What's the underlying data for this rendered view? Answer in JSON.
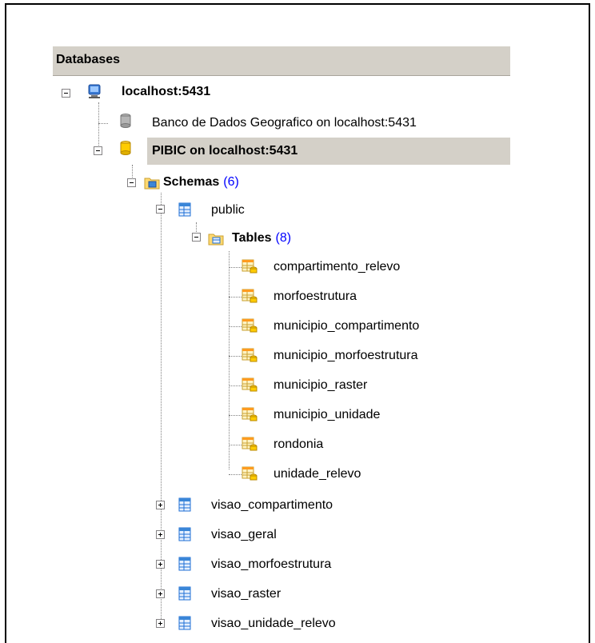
{
  "panel": {
    "header": "Databases"
  },
  "tree": {
    "server": {
      "label": "localhost:5431"
    },
    "db_geo": {
      "label": "Banco de Dados Geografico on localhost:5431"
    },
    "db_pibic": {
      "label": "PIBIC on localhost:5431"
    },
    "schemas": {
      "label": "Schemas",
      "count": "(6)"
    },
    "schema_public": {
      "label": "public"
    },
    "tables": {
      "label": "Tables",
      "count": "(8)"
    },
    "table_items": [
      "compartimento_relevo",
      "morfoestrutura",
      "municipio_compartimento",
      "municipio_morfoestrutura",
      "municipio_raster",
      "municipio_unidade",
      "rondonia",
      "unidade_relevo"
    ],
    "other_schemas": [
      "visao_compartimento",
      "visao_geral",
      "visao_morfoestrutura",
      "visao_raster",
      "visao_unidade_relevo"
    ]
  },
  "icons": {
    "server": "server-icon",
    "database": "database-icon",
    "schemas": "schemas-folder-icon",
    "schema": "schema-icon",
    "tables": "tables-folder-icon",
    "table": "table-icon"
  }
}
